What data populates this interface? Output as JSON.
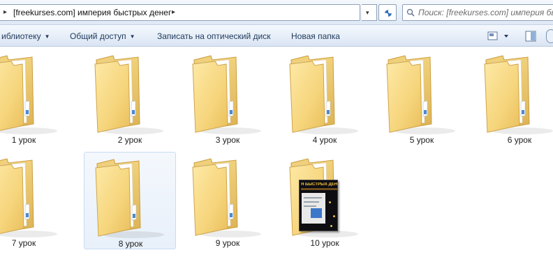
{
  "address_bar": {
    "path_text": "[freekurses.com] империя быстрых денег",
    "lead_arrow": "▸",
    "trail_arrow": "▸",
    "dropdown_arrow": "▾"
  },
  "search": {
    "placeholder": "Поиск: [freekurses.com] империя быс..."
  },
  "toolbar": {
    "library_label": "иблиотеку",
    "share_label": "Общий доступ",
    "burn_label": "Записать на оптический диск",
    "new_folder_label": "Новая папка",
    "caret": "▼",
    "icons": [
      "view-options-icon",
      "preview-pane-icon"
    ]
  },
  "folders": [
    {
      "label": "1 урок",
      "icon": "folder-icon"
    },
    {
      "label": "2 урок",
      "icon": "folder-icon"
    },
    {
      "label": "3 урок",
      "icon": "folder-icon"
    },
    {
      "label": "4 урок",
      "icon": "folder-icon"
    },
    {
      "label": "5 урок",
      "icon": "folder-icon"
    },
    {
      "label": "6 урок",
      "icon": "folder-icon"
    },
    {
      "label": "7 урок",
      "icon": "folder-icon"
    },
    {
      "label": "8 урок",
      "icon": "folder-icon",
      "selected": true
    },
    {
      "label": "9 урок",
      "icon": "folder-icon"
    },
    {
      "label": "10 урок",
      "icon": "folder-with-thumbnail-icon"
    }
  ],
  "thumbnail": {
    "title": "Я БЫСТРЫХ ДЕНЕ"
  },
  "colors": {
    "folder_front": "#f7d97e",
    "folder_back": "#e9c060",
    "toolbar_text": "#1e395b",
    "selection_border": "#c9dbef"
  }
}
